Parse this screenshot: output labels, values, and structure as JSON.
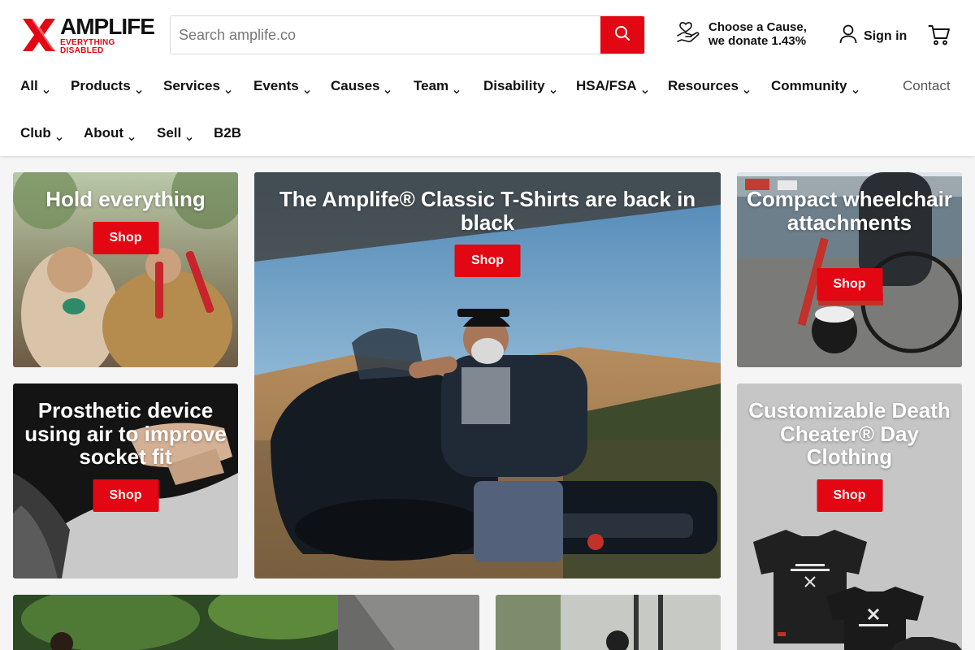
{
  "header": {
    "logo": {
      "name": "AMPLIFE",
      "tagline": "EVERYTHING DISABLED",
      "icon": "amplife-x-logo"
    },
    "search": {
      "placeholder": "Search amplife.co",
      "value": "",
      "icon": "search-icon"
    },
    "cause": {
      "line1": "Choose a Cause,",
      "line2": "we donate 1.43%",
      "icon": "hand-heart-icon"
    },
    "signin": {
      "label": "Sign in",
      "icon": "user-icon"
    },
    "cart": {
      "icon": "cart-icon"
    }
  },
  "nav": {
    "row1": [
      {
        "label": "All"
      },
      {
        "label": "Products"
      },
      {
        "label": "Services"
      },
      {
        "label": "Events"
      },
      {
        "label": "Causes"
      },
      {
        "label": "Team"
      },
      {
        "label": "Disability"
      },
      {
        "label": "HSA/FSA"
      },
      {
        "label": "Resources"
      },
      {
        "label": "Community"
      }
    ],
    "contact": "Contact",
    "row2": [
      {
        "label": "Club"
      },
      {
        "label": "About"
      },
      {
        "label": "Sell"
      },
      {
        "label": "B2B"
      }
    ]
  },
  "tiles": {
    "hold": {
      "title": "Hold everything",
      "button": "Shop"
    },
    "tshirts": {
      "title": "The Amplife® Classic T-Shirts are back in black",
      "button": "Shop"
    },
    "wheelchair": {
      "title": "Compact wheelchair attachments",
      "button": "Shop"
    },
    "prosthetic": {
      "title": "Prosthetic device using air to improve socket fit",
      "button": "Shop"
    },
    "deathcheater": {
      "title": "Customizable Death Cheater® Day Clothing",
      "button": "Shop"
    }
  },
  "colors": {
    "accent": "#e30613",
    "text": "#111111",
    "background": "#f5f5f5"
  }
}
